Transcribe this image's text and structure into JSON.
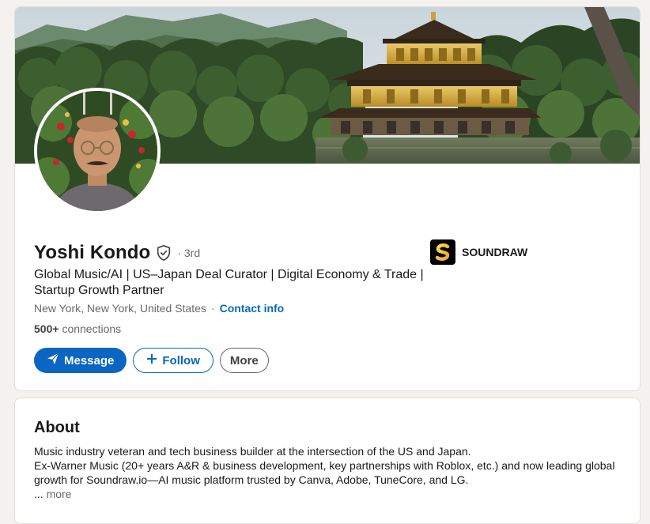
{
  "profile": {
    "name": "Yoshi Kondo",
    "degree": "· 3rd",
    "headline": "Global Music/AI | US–Japan Deal Curator | Digital Economy & Trade | Startup Growth Partner",
    "location": "New York, New York, United States",
    "contact_label": "Contact info",
    "connections_count": "500+",
    "connections_label": "connections"
  },
  "actions": {
    "message_label": "Message",
    "follow_label": "Follow",
    "more_label": "More"
  },
  "company": {
    "name": "SOUNDRAW",
    "logo_letter": "S"
  },
  "about": {
    "title": "About",
    "line1": "Music industry veteran and tech business builder at the intersection of the US and Japan.",
    "line2": "Ex-Warner Music (20+ years A&R & business development, key partnerships with Roblox, etc.) and now leading global growth for Soundraw.io—AI music platform trusted by Canva, Adobe, TuneCore, and LG.",
    "more_prefix": "... ",
    "more_label": "more"
  },
  "colors": {
    "accent": "#0a66c2",
    "background": "#f4f2ee",
    "card": "#ffffff"
  },
  "icons": {
    "verified": "shield-check-icon",
    "message": "paper-plane-icon",
    "follow": "plus-icon"
  }
}
